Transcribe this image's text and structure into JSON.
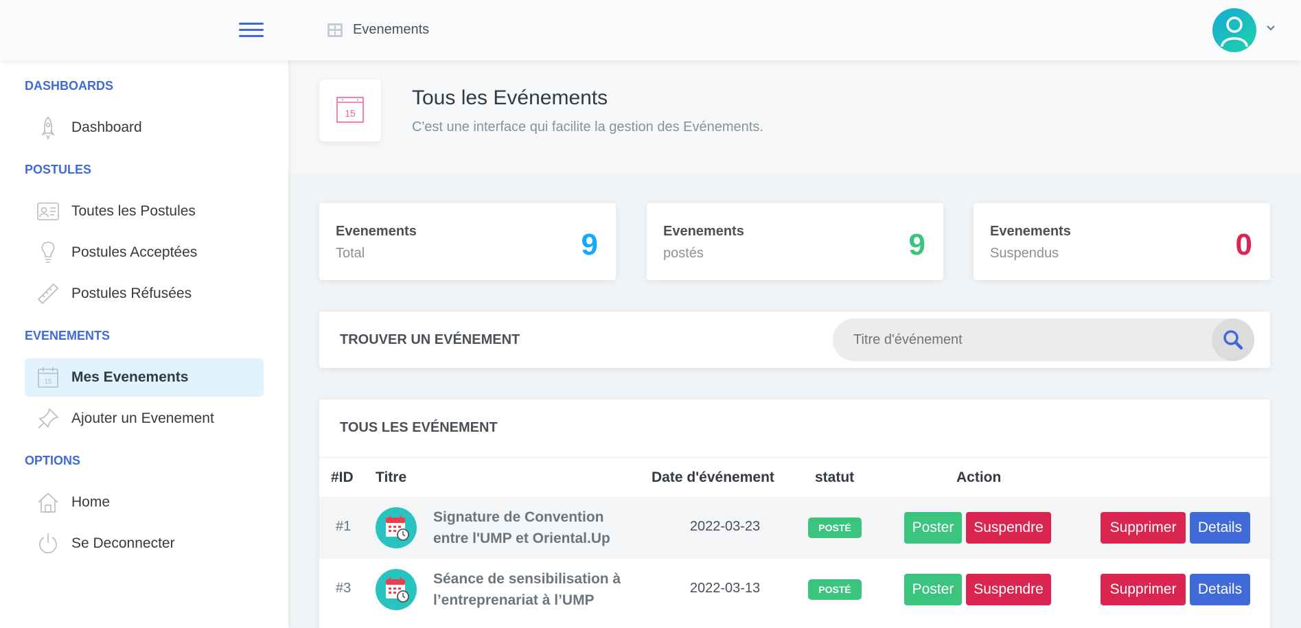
{
  "header": {
    "breadcrumb": "Evenements"
  },
  "sidebar": {
    "sections": [
      {
        "heading": "DASHBOARDS",
        "items": [
          {
            "label": "Dashboard",
            "icon": "rocket-icon"
          }
        ]
      },
      {
        "heading": "POSTULES",
        "items": [
          {
            "label": "Toutes les Postules",
            "icon": "id-card-icon"
          },
          {
            "label": "Postules Acceptées",
            "icon": "lightbulb-icon"
          },
          {
            "label": "Postules Réfusées",
            "icon": "ruler-icon"
          }
        ]
      },
      {
        "heading": "EVENEMENTS",
        "items": [
          {
            "label": "Mes Evenements",
            "icon": "calendar-icon",
            "active": true
          },
          {
            "label": "Ajouter un Evenement",
            "icon": "pin-icon"
          }
        ]
      },
      {
        "heading": "OPTIONS",
        "items": [
          {
            "label": "Home",
            "icon": "home-icon"
          },
          {
            "label": "Se Deconnecter",
            "icon": "power-icon"
          }
        ]
      }
    ]
  },
  "page": {
    "title": "Tous les Evénements",
    "subtitle": "C'est une interface qui facilite la gestion des Evénements.",
    "calendar_day": "15"
  },
  "stats": [
    {
      "label": "Evenements",
      "sub": "Total",
      "value": "9",
      "color": "#16aaff"
    },
    {
      "label": "Evenements",
      "sub": "postés",
      "value": "9",
      "color": "#3ac47d"
    },
    {
      "label": "Evenements",
      "sub": "Suspendus",
      "value": "0",
      "color": "#d92550"
    }
  ],
  "search": {
    "title": "TROUVER UN EVÉNEMENT",
    "placeholder": "Titre d'événement"
  },
  "table": {
    "title": "TOUS LES EVÉNEMENT",
    "columns": {
      "id": "#ID",
      "title": "Titre",
      "date": "Date d'événement",
      "status": "statut",
      "action": "Action"
    },
    "rows": [
      {
        "id": "#1",
        "title": "Signature de Convention entre l'UMP et Oriental.Up",
        "date": "2022-03-23",
        "status": "POSTÉ"
      },
      {
        "id": "#3",
        "title": "Séance de sensibilisation à l’entreprenariat à l’UMP",
        "date": "2022-03-13",
        "status": "POSTÉ"
      }
    ],
    "buttons": {
      "post": "Poster",
      "suspend": "Suspendre",
      "delete": "Supprimer",
      "details": "Details"
    }
  },
  "colors": {
    "accent": "#3f6ad8",
    "success": "#3ac47d",
    "danger": "#d92550",
    "info": "#16aaff"
  }
}
